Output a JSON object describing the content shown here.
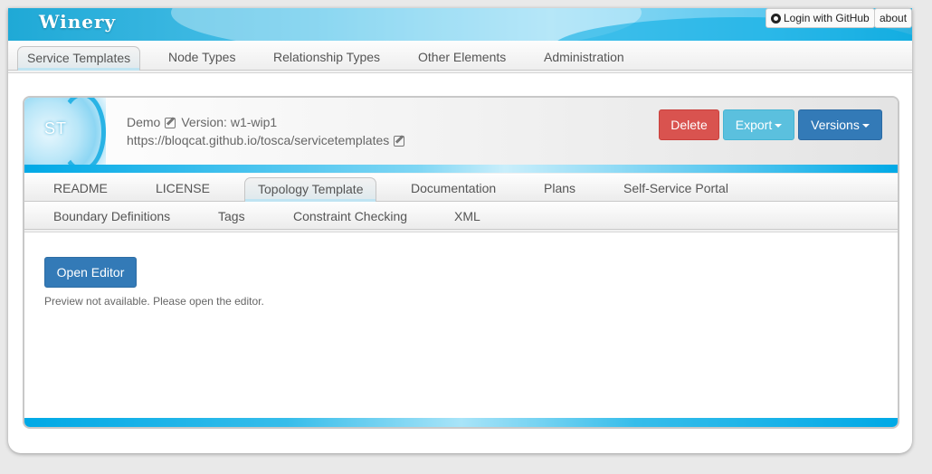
{
  "app": {
    "brand": "Winery",
    "login_label": "Login with GitHub",
    "about_label": "about"
  },
  "main_nav": {
    "items": [
      {
        "label": "Service Templates",
        "active": true
      },
      {
        "label": "Node Types",
        "active": false
      },
      {
        "label": "Relationship Types",
        "active": false
      },
      {
        "label": "Other Elements",
        "active": false
      },
      {
        "label": "Administration",
        "active": false
      }
    ]
  },
  "entity": {
    "badge": "ST",
    "name": "Demo",
    "version_label": "Version: w1-wip1",
    "namespace": "https://bloqcat.github.io/tosca/servicetemplates"
  },
  "actions": {
    "delete_label": "Delete",
    "export_label": "Export",
    "versions_label": "Versions"
  },
  "sub_nav": {
    "row1": [
      {
        "label": "README",
        "active": false
      },
      {
        "label": "LICENSE",
        "active": false
      },
      {
        "label": "Topology Template",
        "active": true
      },
      {
        "label": "Documentation",
        "active": false
      },
      {
        "label": "Plans",
        "active": false
      },
      {
        "label": "Self-Service Portal",
        "active": false
      }
    ],
    "row2": [
      {
        "label": "Boundary Definitions",
        "active": false
      },
      {
        "label": "Tags",
        "active": false
      },
      {
        "label": "Constraint Checking",
        "active": false
      },
      {
        "label": "XML",
        "active": false
      }
    ]
  },
  "content": {
    "open_editor_label": "Open Editor",
    "preview_note": "Preview not available. Please open the editor."
  },
  "colors": {
    "danger": "#d9534f",
    "info": "#5bc0de",
    "primary": "#337ab7",
    "accent": "#00a9e6"
  }
}
